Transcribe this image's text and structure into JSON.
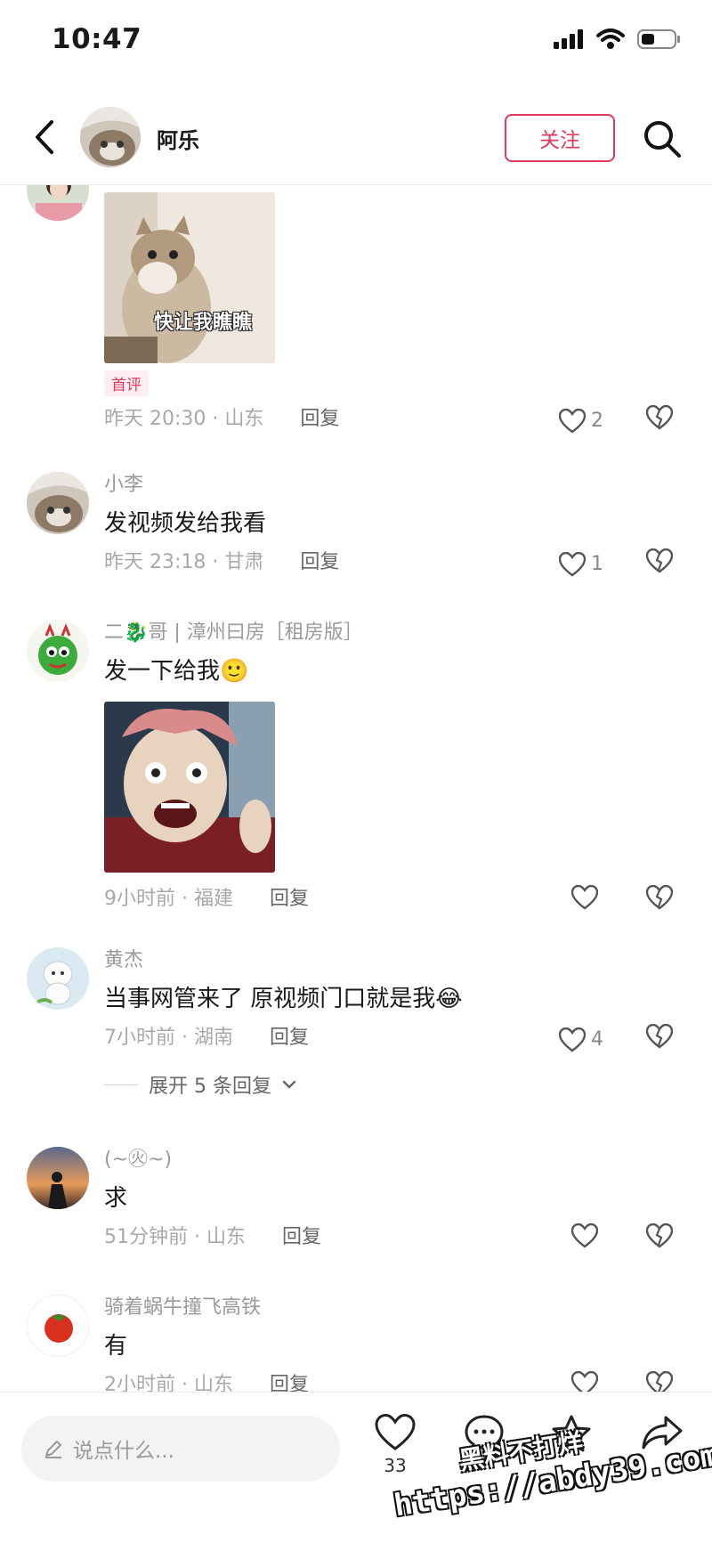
{
  "status_bar": {
    "time": "10:47"
  },
  "header": {
    "name": "阿乐",
    "follow_label": "关注"
  },
  "comments": [
    {
      "username": "",
      "text": "",
      "image_caption": "快让我瞧瞧",
      "badge": "首评",
      "time_location": "昨天 20:30 · 山东",
      "reply_label": "回复",
      "likes": "2"
    },
    {
      "username": "小李",
      "text": "发视频发给我看",
      "time_location": "昨天 23:18 · 甘肃",
      "reply_label": "回复",
      "likes": "1"
    },
    {
      "username": "二🐉哥 | 漳州曰房［租房版］",
      "text": "发一下给我🙂",
      "time_location": "9小时前 · 福建",
      "reply_label": "回复",
      "likes": ""
    },
    {
      "username": "黄杰",
      "text": "当事网管来了 原视频门口就是我😂",
      "time_location": "7小时前 · 湖南",
      "reply_label": "回复",
      "likes": "4",
      "expand_label": "展开 5 条回复"
    },
    {
      "username": "(~㊋~)",
      "text": "求",
      "time_location": "51分钟前 · 山东",
      "reply_label": "回复",
      "likes": ""
    },
    {
      "username": "骑着蜗牛撞飞高铁",
      "text": "有",
      "time_location": "2小时前 · 山东",
      "reply_label": "回复",
      "likes": ""
    }
  ],
  "bottom_bar": {
    "input_placeholder": "说点什么...",
    "like_count": "33"
  },
  "watermark": {
    "line1": "黑料不打烊",
    "line2": "https://abdy39.com"
  },
  "colors": {
    "accent": "#e0395b",
    "muted": "#9a9a9a"
  }
}
